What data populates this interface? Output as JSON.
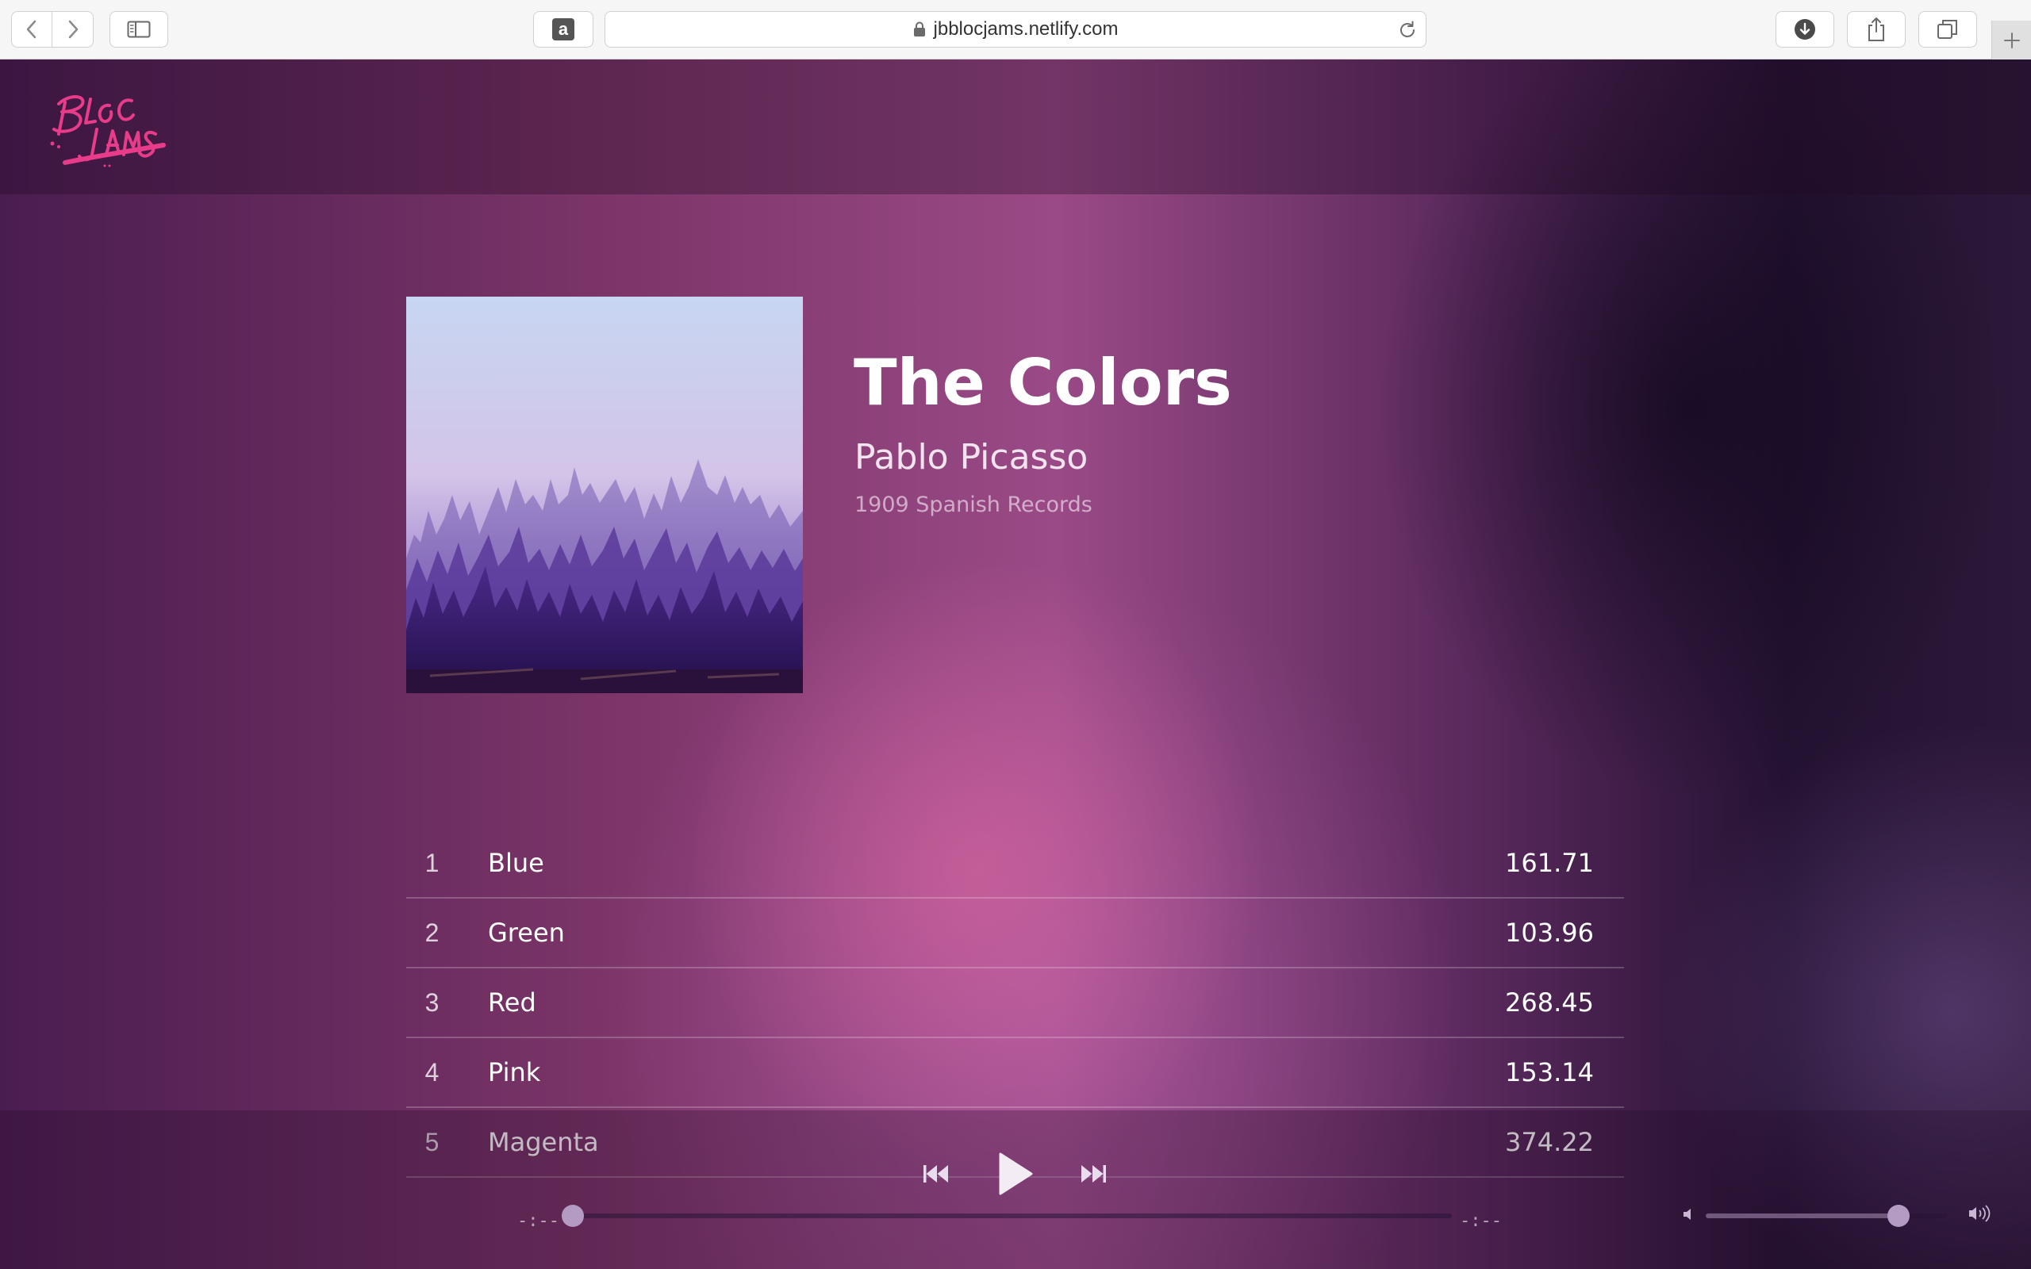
{
  "browser": {
    "url": "jbblocjams.netlify.com",
    "amazon_glyph": "a"
  },
  "icons": {
    "back": "chevron-left-icon",
    "forward": "chevron-right-icon",
    "sidebar": "sidebar-icon",
    "amazon": "amazon-icon",
    "lock": "lock-icon",
    "reload": "reload-icon",
    "download": "download-icon",
    "share": "share-icon",
    "tabs": "tabs-icon",
    "new_tab": "plus-icon",
    "previous": "skip-previous-icon",
    "play": "play-icon",
    "next": "skip-next-icon",
    "volume_low": "volume-low-icon",
    "volume_high": "volume-high-icon"
  },
  "colors": {
    "logo": "#e83c8a",
    "text": "#ffffff",
    "thumb": "#b49bc4"
  },
  "album": {
    "title": "The Colors",
    "artist": "Pablo Picasso",
    "release": "1909 Spanish Records",
    "songs": [
      {
        "number": "1",
        "title": "Blue",
        "duration": "161.71"
      },
      {
        "number": "2",
        "title": "Green",
        "duration": "103.96"
      },
      {
        "number": "3",
        "title": "Red",
        "duration": "268.45"
      },
      {
        "number": "4",
        "title": "Pink",
        "duration": "153.14"
      },
      {
        "number": "5",
        "title": "Magenta",
        "duration": "374.22"
      }
    ]
  },
  "player": {
    "current_time": "-:--",
    "total_time": "-:--",
    "seek_fraction": 0.0,
    "volume_fraction": 0.8
  }
}
